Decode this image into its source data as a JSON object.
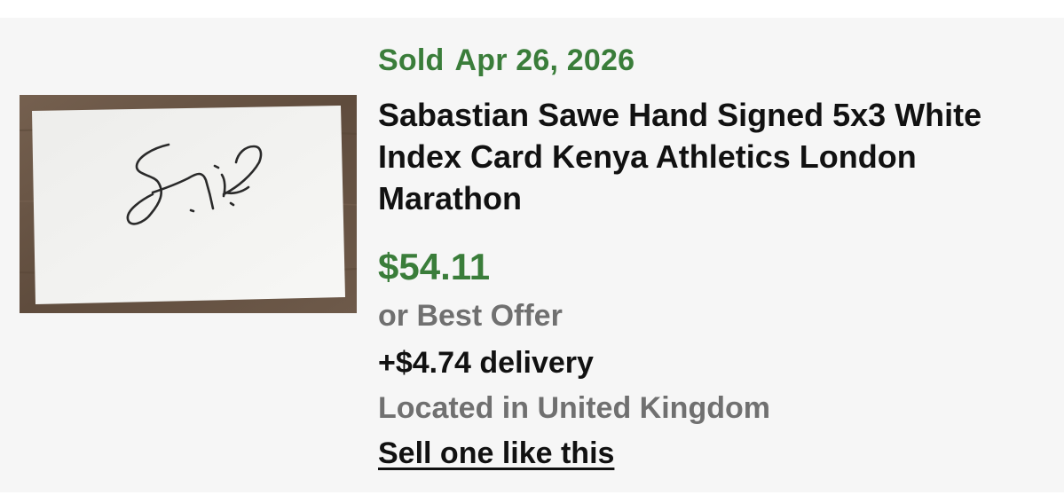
{
  "listing": {
    "status": "Sold",
    "sold_date": "Apr 26, 2026",
    "title": "Sabastian Sawe Hand Signed 5x3 White Index Card Kenya Athletics London Marathon",
    "price": "$54.11",
    "best_offer": "or Best Offer",
    "delivery": "+$4.74 delivery",
    "location": "Located in United Kingdom",
    "sell_similar": "Sell one like this",
    "image": "signed-index-card-photo"
  },
  "colors": {
    "accent_green": "#3a7d3a",
    "muted_gray": "#707070",
    "text_dark": "#111111",
    "card_bg": "#f6f6f6",
    "wood_bg": "#6b5848"
  }
}
